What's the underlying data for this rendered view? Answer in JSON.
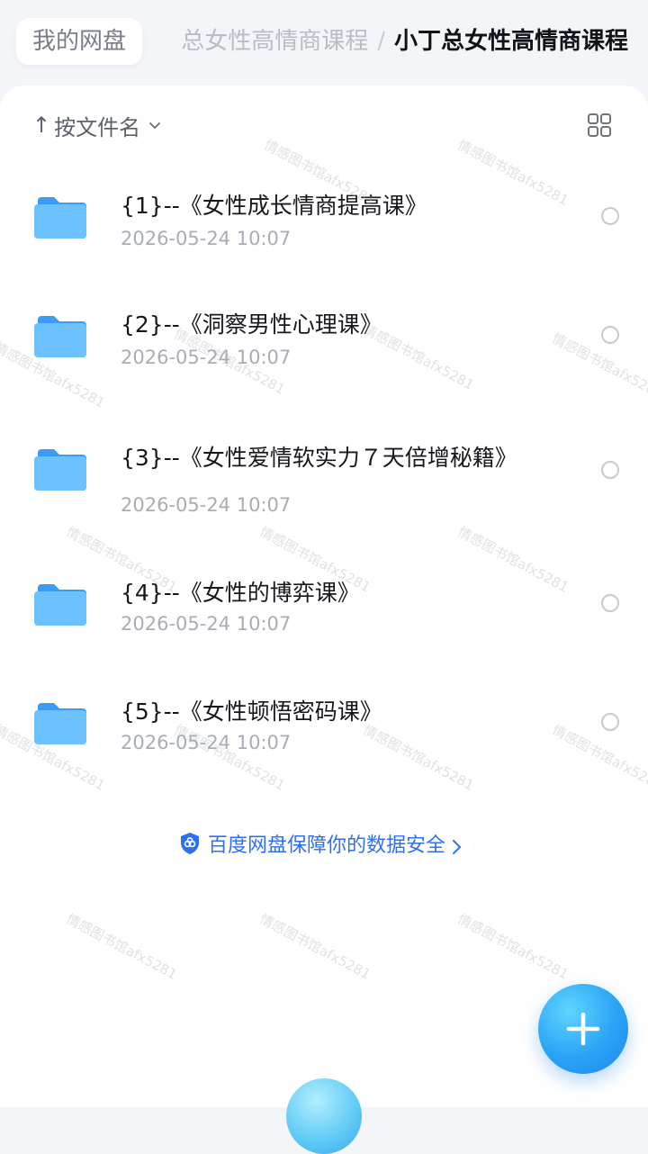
{
  "breadcrumb": {
    "root": "我的网盘",
    "middle": "总女性高情商课程",
    "separator": "/",
    "current": "小丁总女性高情商课程"
  },
  "toolbar": {
    "sort_arrow": "↑",
    "sort_label": "按文件名",
    "chevron_icon": "chevron-down-icon",
    "view_toggle_icon": "grid-view-icon"
  },
  "files": [
    {
      "name": "{1}--《女性成长情商提高课》",
      "date": "2026-05-24 10:07"
    },
    {
      "name": "{2}--《洞察男性心理课》",
      "date": "2026-05-24 10:07"
    },
    {
      "name": "{3}--《女性爱情软实力７天倍增秘籍》",
      "date": "2026-05-24 10:07"
    },
    {
      "name": "{4}--《女性的博弈课》",
      "date": "2026-05-24 10:07"
    },
    {
      "name": "{5}--《女性顿悟密码课》",
      "date": "2026-05-24 10:07"
    }
  ],
  "security": {
    "text": "百度网盘保障你的数据安全",
    "icon": "shield-icon"
  },
  "watermark": "情感图书馆afx5281",
  "fab": {
    "icon": "plus-icon"
  },
  "colors": {
    "accent": "#2f6ff1",
    "folder": "#4aa8f8",
    "background": "#f3f5f9"
  }
}
